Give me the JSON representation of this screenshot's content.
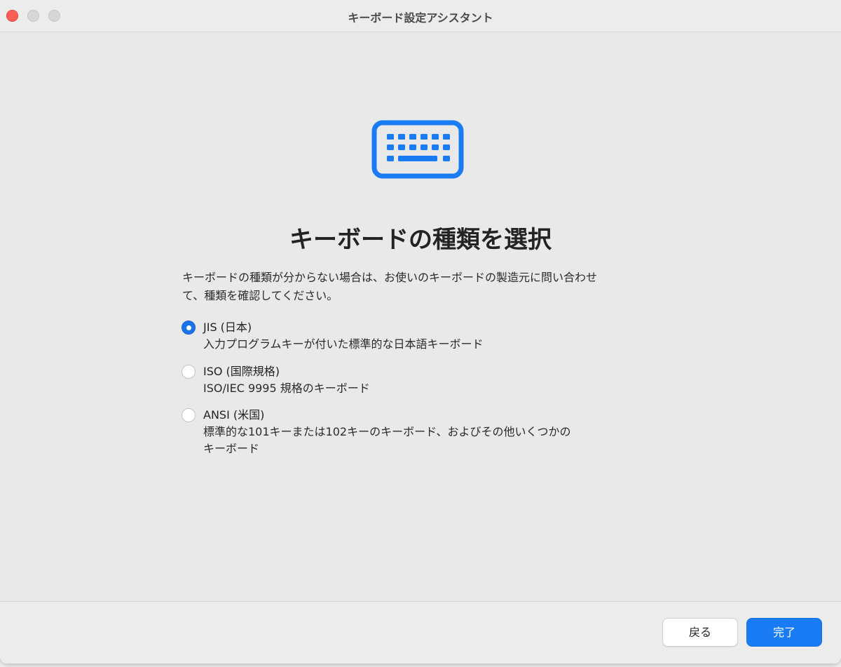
{
  "window": {
    "title": "キーボード設定アシスタント"
  },
  "main": {
    "icon": "keyboard-icon",
    "heading": "キーボードの種類を選択",
    "description": "キーボードの種類が分からない場合は、お使いのキーボードの製造元に問い合わせ\nて、種類を確認してください。",
    "options": [
      {
        "title": "JIS (日本)",
        "description": "入力プログラムキーが付いた標準的な日本語キーボード",
        "selected": true
      },
      {
        "title": "ISO (国際規格)",
        "description": "ISO/IEC 9995 規格のキーボード",
        "selected": false
      },
      {
        "title": "ANSI (米国)",
        "description": "標準的な101キーまたは102キーのキーボード、およびその他いくつかの\nキーボード",
        "selected": false
      }
    ]
  },
  "footer": {
    "back_label": "戻る",
    "done_label": "完了"
  },
  "colors": {
    "accent": "#1a7cf5",
    "close_button": "#fe5f57"
  }
}
